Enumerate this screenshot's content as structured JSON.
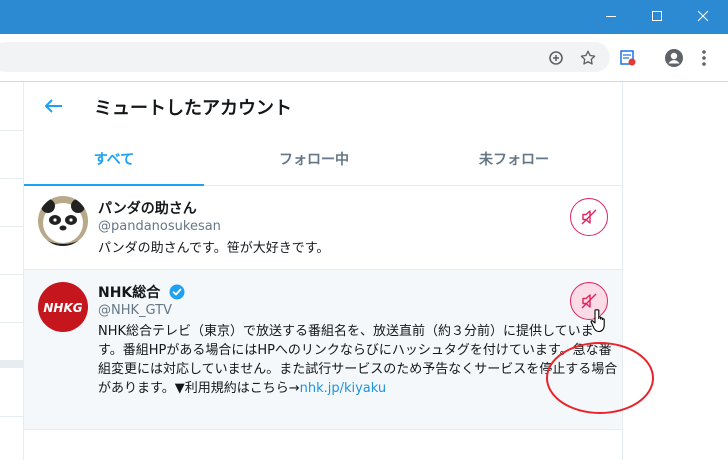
{
  "window": {
    "controls": {
      "minimize_icon": "minimize-icon",
      "maximize_icon": "maximize-icon",
      "close_icon": "close-icon"
    },
    "title_bar_color": "#2b8ad2"
  },
  "browser": {
    "toolbar_icons": [
      "zoom-icon",
      "star-icon",
      "extension-icon",
      "profile-icon",
      "menu-icon"
    ]
  },
  "page": {
    "title": "ミュートしたアカウント",
    "back_icon": "back-arrow-icon"
  },
  "tabs": [
    {
      "label": "すべて",
      "active": true
    },
    {
      "label": "フォロー中",
      "active": false
    },
    {
      "label": "未フォロー",
      "active": false
    }
  ],
  "accounts": [
    {
      "name": "パンダの助さん",
      "handle": "@pandanosukesan",
      "bio": "パンダの助さんです。笹が大好きです。",
      "verified": false,
      "muted": true
    },
    {
      "name": "NHK総合",
      "handle": "@NHK_GTV",
      "bio": "NHK総合テレビ（東京）で放送する番組名を、放送直前（約３分前）に提供しています。番組HPがある場合にはHPへのリンクならびにハッシュタグを付けています。急な番組変更には対応していません。また試行サービスのため予告なくサービスを停止する場合があります。▼利用規約はこちら→",
      "bio_link": "nhk.jp/kiyaku",
      "verified": true,
      "muted": true,
      "avatar_text": "NHKG"
    }
  ],
  "colors": {
    "accent": "#1da1f2",
    "mute": "#e0245e",
    "link": "#1b95e0",
    "highlight": "#e8242c"
  }
}
